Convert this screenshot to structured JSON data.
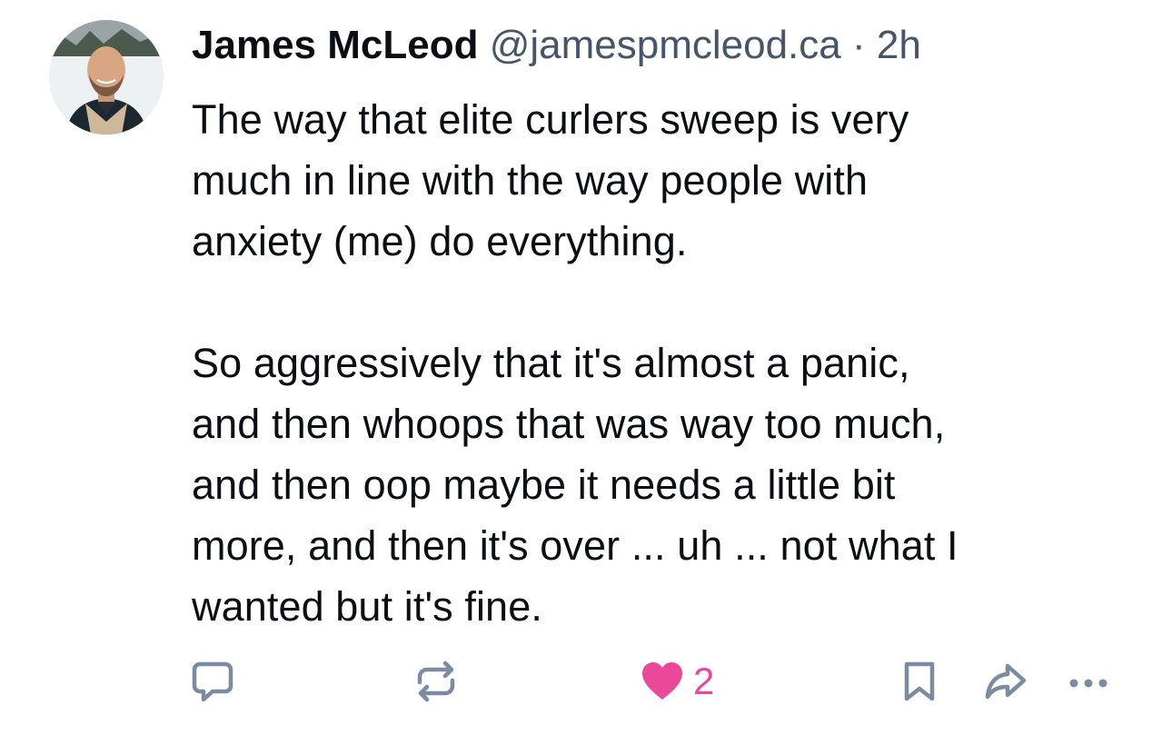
{
  "post": {
    "author": {
      "display_name": "James McLeod",
      "handle": "@jamespmcleod.ca",
      "avatar_icon": "avatar-photo"
    },
    "separator": "·",
    "time": "2h",
    "text": "The way that elite curlers sweep is very\nmuch in line with the way people with\nanxiety (me) do everything.\n\nSo aggressively that it's almost a panic,\nand then whoops that was way too much,\nand then oop maybe it needs a little bit\nmore, and then it's over ... uh ... not what I\nwanted but it's fine."
  },
  "actions": {
    "reply": {
      "icon": "reply-icon"
    },
    "repost": {
      "icon": "repost-icon"
    },
    "like": {
      "icon": "heart-icon",
      "count": "2",
      "liked": true
    },
    "bookmark": {
      "icon": "bookmark-icon"
    },
    "share": {
      "icon": "share-icon"
    },
    "more": {
      "icon": "more-icon"
    }
  },
  "colors": {
    "text": "#0b0f14",
    "muted": "#45566b",
    "icon": "#7b8ba1",
    "like": "#ec4899"
  }
}
